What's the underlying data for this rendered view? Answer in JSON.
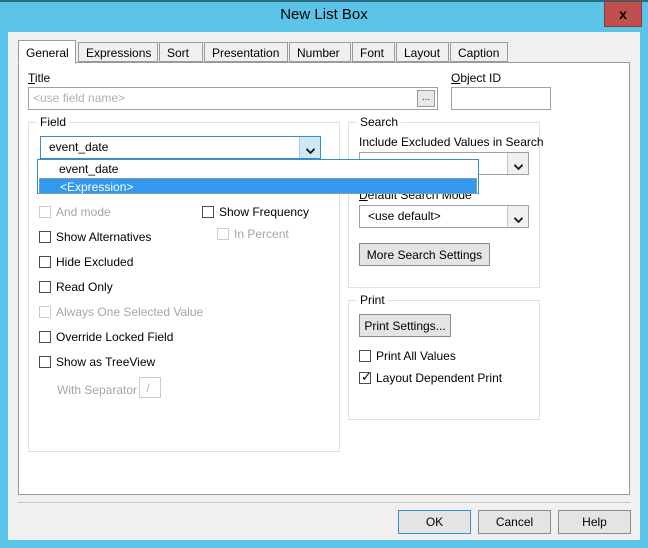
{
  "window": {
    "title": "New List Box",
    "close_label": "x",
    "titlebar_color": "#5bc4e8",
    "close_color": "#c0504d"
  },
  "tabs": [
    {
      "label": "General",
      "active": true
    },
    {
      "label": "Expressions",
      "active": false
    },
    {
      "label": "Sort",
      "active": false
    },
    {
      "label": "Presentation",
      "active": false
    },
    {
      "label": "Number",
      "active": false
    },
    {
      "label": "Font",
      "active": false
    },
    {
      "label": "Layout",
      "active": false
    },
    {
      "label": "Caption",
      "active": false
    }
  ],
  "general": {
    "title_label": "Title",
    "title_value": "",
    "title_placeholder": "<use field name>",
    "title_browse_label": "...",
    "object_id_label": "Object ID",
    "object_id_value": "",
    "field_group": {
      "legend": "Field",
      "selected_value": "event_date",
      "dropdown_open": true,
      "options": [
        {
          "label": "event_date",
          "selected": false
        },
        {
          "label": "<Expression>",
          "selected": true
        }
      ]
    },
    "checkboxes": [
      {
        "label": "And mode",
        "checked": false,
        "disabled": true,
        "accel": "n"
      },
      {
        "label": "Show Alternatives",
        "checked": false,
        "disabled": false,
        "accel": "S"
      },
      {
        "label": "Hide Excluded",
        "checked": false,
        "disabled": false,
        "accel": "H"
      },
      {
        "label": "Read Only",
        "checked": false,
        "disabled": false,
        "accel": "R"
      },
      {
        "label": "Always One Selected Value",
        "checked": false,
        "disabled": true,
        "accel": "l"
      },
      {
        "label": "Override Locked Field",
        "checked": false,
        "disabled": false,
        "accel": "v"
      },
      {
        "label": "Show as TreeView",
        "checked": false,
        "disabled": false,
        "accel": ""
      }
    ],
    "separator_label": "With Separator",
    "separator_value": "/",
    "show_frequency": {
      "label": "Show Frequency",
      "checked": false,
      "disabled": false
    },
    "in_percent": {
      "label": "In Percent",
      "checked": false,
      "disabled": true
    },
    "search_group": {
      "legend": "Search",
      "include_excluded_label": "Include Excluded Values in Search",
      "include_excluded_value": "",
      "default_search_mode_label": "Default Search Mode",
      "default_search_mode_value": "<use default>",
      "more_search_settings_label": "More Search Settings"
    },
    "print_group": {
      "legend": "Print",
      "print_settings_label": "Print Settings...",
      "print_all_values": {
        "label": "Print All Values",
        "checked": false
      },
      "layout_dependent_print": {
        "label": "Layout Dependent Print",
        "checked": true
      }
    }
  },
  "footer": {
    "ok_label": "OK",
    "cancel_label": "Cancel",
    "help_label": "Help"
  },
  "icons": {
    "chevron_down": "chevron-down-icon",
    "close": "close-icon"
  }
}
